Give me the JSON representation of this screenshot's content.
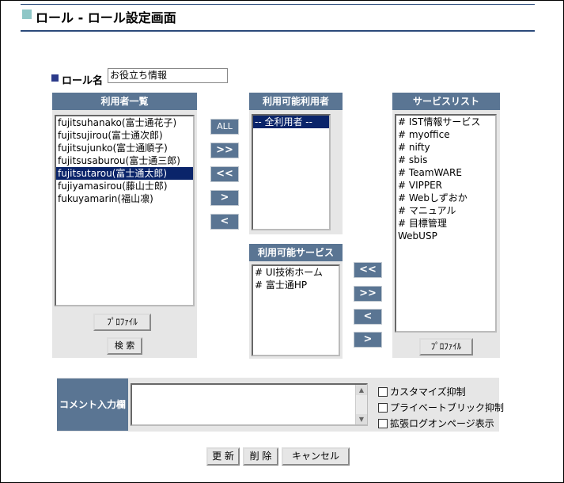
{
  "header": {
    "title": "ロール - ロール設定画面"
  },
  "role": {
    "label": "ロール名",
    "value": "お役立ち情報"
  },
  "users_panel": {
    "title": "利用者一覧",
    "items": [
      "fujitsuhanako(富士通花子)",
      "fujitsujirou(富士通次郎)",
      "fujitsujunko(富士通順子)",
      "fujitsusaburou(富士通三郎)",
      "fujitsutarou(富士通太郎)",
      "fujiyamasirou(藤山士郎)",
      "fukuyamarin(福山凛)"
    ],
    "selected_index": 4,
    "profile_label": "ﾌﾟﾛﾌｧｲﾙ",
    "search_label": "検 索"
  },
  "middle_buttons": {
    "all": "ALL",
    "add_all": ">>",
    "remove_all": "<<",
    "add": ">",
    "remove": "<"
  },
  "available_users_panel": {
    "title": "利用可能利用者",
    "items": [
      "-- 全利用者 --"
    ],
    "selected_index": 0
  },
  "available_services_panel": {
    "title": "利用可能サービス",
    "items": [
      "# UI技術ホーム",
      "# 富士通HP"
    ]
  },
  "service_buttons": {
    "remove_all": "<<",
    "add_all": ">>",
    "remove": "<",
    "add": ">"
  },
  "service_list_panel": {
    "title": "サービスリスト",
    "items": [
      "# IST情報サービス",
      "# myoffice",
      "# nifty",
      "# sbis",
      "# TeamWARE",
      "# VIPPER",
      "# Webしずおか",
      "# マニュアル",
      "# 目標管理",
      "WebUSP"
    ],
    "profile_label": "ﾌﾟﾛﾌｧｲﾙ"
  },
  "comment": {
    "label": "コメント入力欄",
    "value": "",
    "options": [
      {
        "label": "カスタマイズ抑制",
        "checked": false
      },
      {
        "label": "プライベートブリック抑制",
        "checked": false
      },
      {
        "label": "拡張ログオンページ表示",
        "checked": false
      }
    ]
  },
  "footer": {
    "update": "更 新",
    "delete": "削 除",
    "cancel": "キャンセル"
  }
}
